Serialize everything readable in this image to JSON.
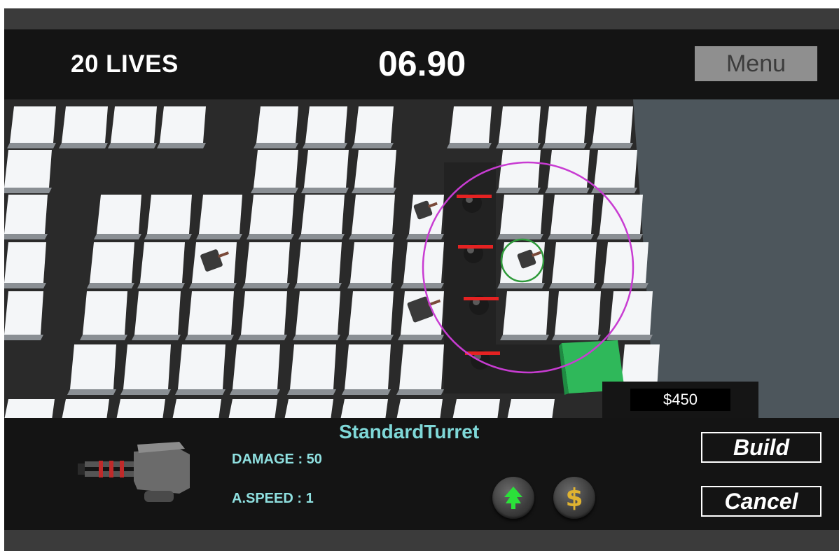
{
  "hud": {
    "lives": "20 LIVES",
    "timer": "06.90",
    "menu_label": "Menu"
  },
  "shop": {
    "price": "$450"
  },
  "turret_info": {
    "name": "StandardTurret",
    "damage": "DAMAGE : 50",
    "attack_speed": "A.SPEED : 1",
    "build_label": "Build",
    "cancel_label": "Cancel",
    "upgrade_icon": "arrow-up-icon",
    "sell_icon": "dollar-icon",
    "sell_glyph": "$"
  },
  "colors": {
    "range_ring": "#c83cd2",
    "selection_ring": "#2e9a3a",
    "build_marker": "#2fb85a",
    "enemy_health": "#e52222",
    "upgrade_arrow": "#2be03a",
    "sell_symbol": "#e0b330"
  }
}
